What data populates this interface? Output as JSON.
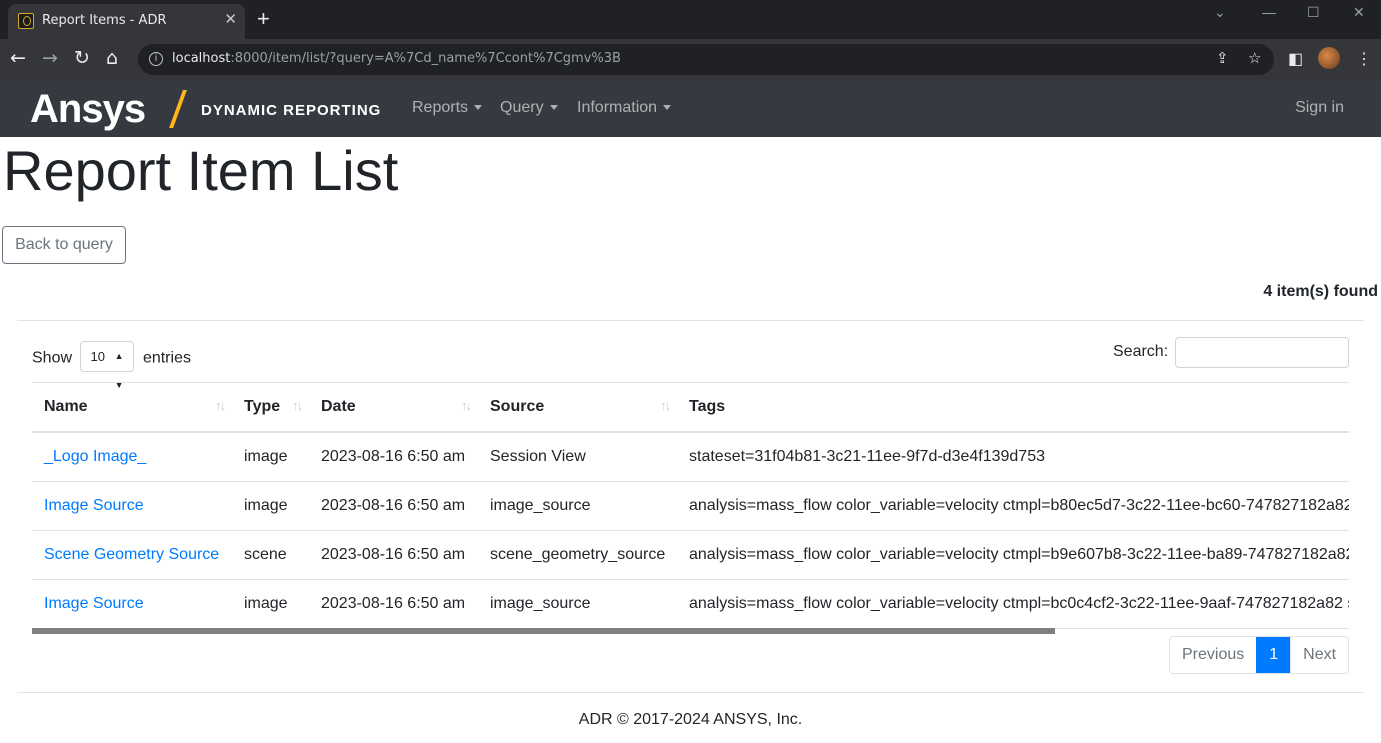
{
  "browser": {
    "tab_title": "Report Items - ADR",
    "url_host": "localhost",
    "url_rest": ":8000/item/list/?query=A%7Cd_name%7Ccont%7Cgmv%3B"
  },
  "nav": {
    "brand": "Ansys",
    "brand_sub": "DYNAMIC REPORTING",
    "menus": [
      "Reports",
      "Query",
      "Information"
    ],
    "sign_in": "Sign in"
  },
  "page": {
    "title": "Report Item List",
    "back_button": "Back to query",
    "found": "4 item(s) found",
    "show_label": "Show",
    "entries_label": "entries",
    "page_size": "10",
    "search_label": "Search:"
  },
  "table": {
    "columns": [
      "Name",
      "Type",
      "Date",
      "Source",
      "Tags"
    ],
    "rows": [
      {
        "name": "_Logo Image_",
        "type": "image",
        "date": "2023-08-16 6:50 am",
        "source": "Session View",
        "tags": "stateset=31f04b81-3c21-11ee-9f7d-d3e4f139d753"
      },
      {
        "name": "Image Source",
        "type": "image",
        "date": "2023-08-16 6:50 am",
        "source": "image_source",
        "tags": "analysis=mass_flow color_variable=velocity ctmpl=b80ec5d7-3c22-11ee-bc60-747827182a82"
      },
      {
        "name": "Scene Geometry Source",
        "type": "scene",
        "date": "2023-08-16 6:50 am",
        "source": "scene_geometry_source",
        "tags": "analysis=mass_flow color_variable=velocity ctmpl=b9e607b8-3c22-11ee-ba89-747827182a82"
      },
      {
        "name": "Image Source",
        "type": "image",
        "date": "2023-08-16 6:50 am",
        "source": "image_source",
        "tags": "analysis=mass_flow color_variable=velocity ctmpl=bc0c4cf2-3c22-11ee-9aaf-747827182a82 s"
      }
    ]
  },
  "pagination": {
    "previous": "Previous",
    "current": "1",
    "next": "Next"
  },
  "footer": "ADR © 2017-2024 ANSYS, Inc."
}
